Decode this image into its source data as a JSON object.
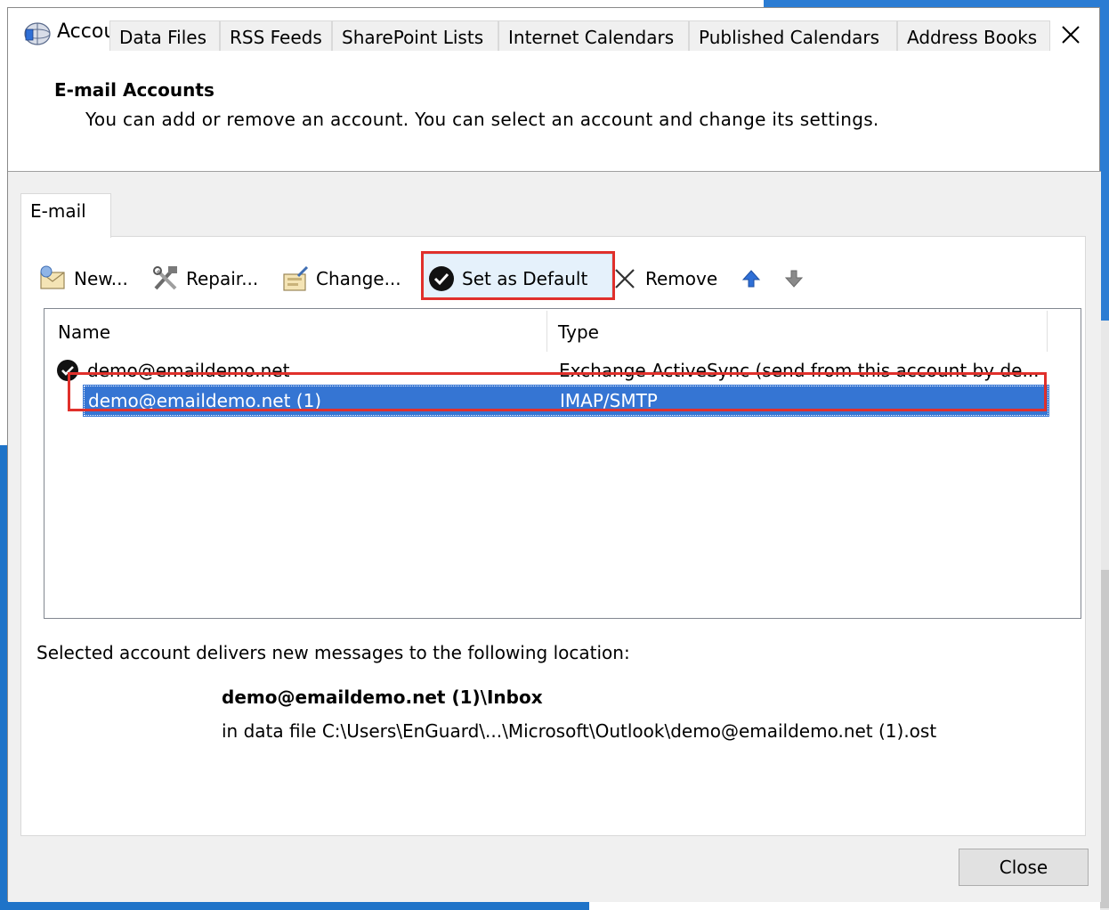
{
  "window": {
    "title": "Account Settings"
  },
  "header": {
    "title": "E-mail Accounts",
    "description": "You can add or remove an account. You can select an account and change its settings."
  },
  "tabs": [
    {
      "label": "E-mail",
      "active": true
    },
    {
      "label": "Data Files"
    },
    {
      "label": "RSS Feeds"
    },
    {
      "label": "SharePoint Lists"
    },
    {
      "label": "Internet Calendars"
    },
    {
      "label": "Published Calendars"
    },
    {
      "label": "Address Books"
    }
  ],
  "toolbar": {
    "new_label": "New...",
    "repair_label": "Repair...",
    "change_label": "Change...",
    "set_default_label": "Set as Default",
    "remove_label": "Remove",
    "icons": {
      "new": "new-account-icon",
      "repair": "repair-tools-icon",
      "change": "change-settings-icon",
      "set_default": "checkmark-circle-icon",
      "remove": "remove-x-icon",
      "move_up": "arrow-up-icon",
      "move_down": "arrow-down-icon"
    }
  },
  "accounts_list": {
    "columns": {
      "name": "Name",
      "type": "Type"
    },
    "rows": [
      {
        "name": "demo@emaildemo.net",
        "type": "Exchange ActiveSync (send from this account by de...",
        "default": true
      },
      {
        "name": "demo@emaildemo.net (1)",
        "type": "IMAP/SMTP",
        "selected": true
      }
    ]
  },
  "delivery": {
    "label": "Selected account delivers new messages to the following location:",
    "folder": "demo@emaildemo.net (1)\\Inbox",
    "data_file": "in data file C:\\Users\\EnGuard\\...\\Microsoft\\Outlook\\demo@emaildemo.net (1).ost"
  },
  "buttons": {
    "close_label": "Close"
  },
  "colors": {
    "selection": "#3575d3",
    "highlight_box": "#e0302b",
    "arrow_up": "#2f6fd6",
    "arrow_down": "#8a8a8a"
  }
}
